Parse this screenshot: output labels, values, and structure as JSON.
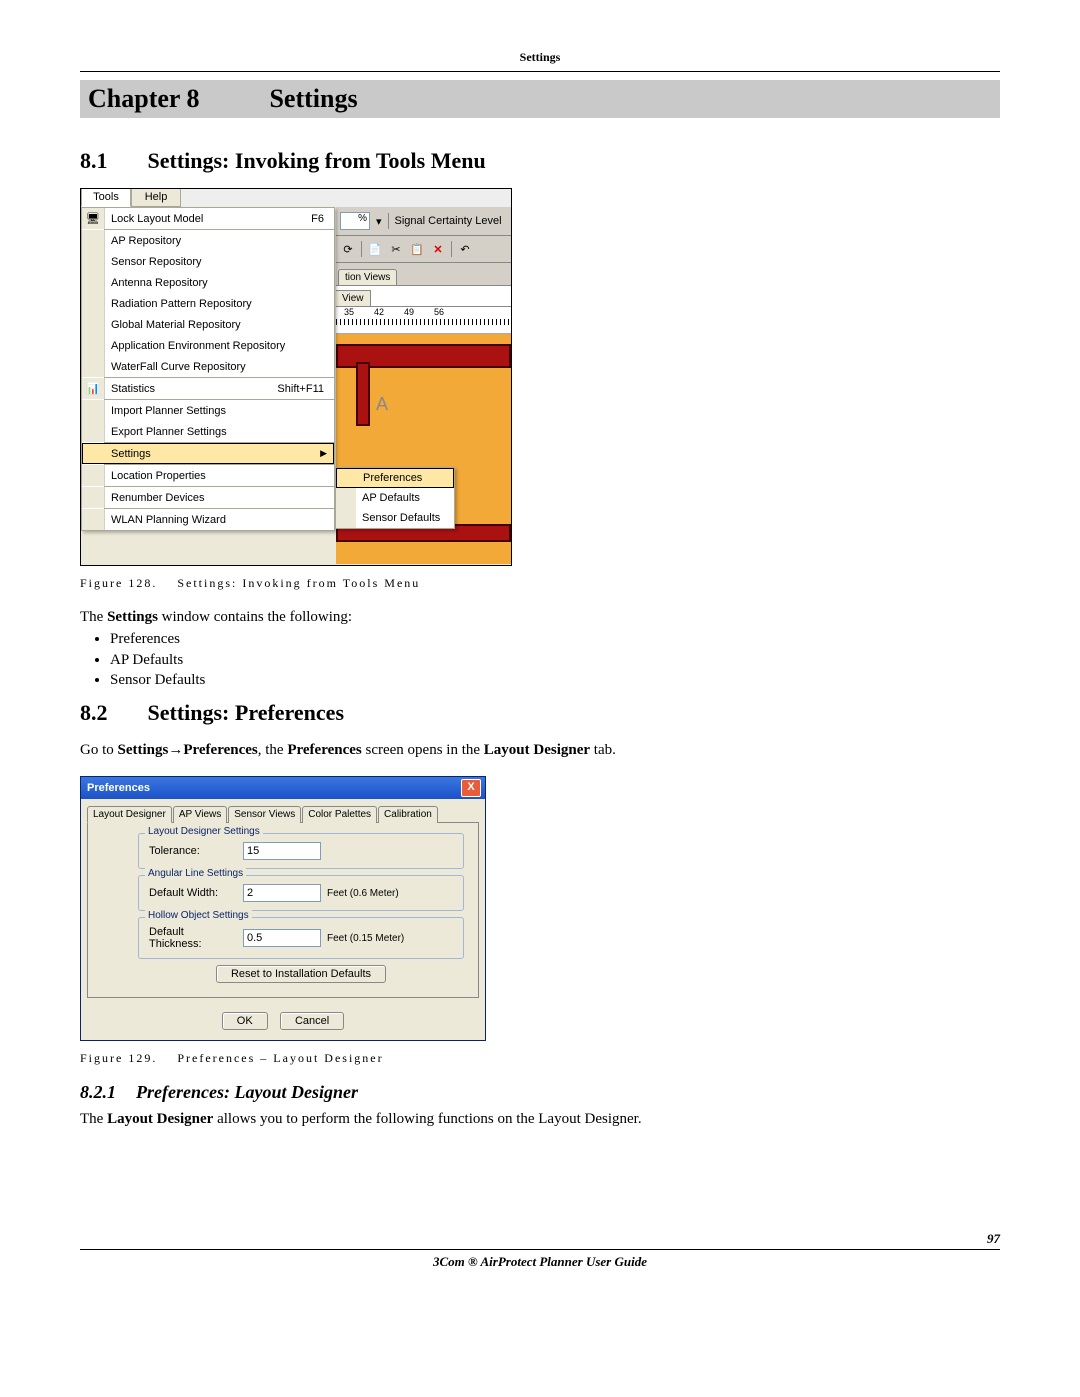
{
  "running_head": "Settings",
  "chapter_label": "Chapter 8",
  "chapter_title": "Settings",
  "sec_81_num": "8.1",
  "sec_81_title": "Settings: Invoking from Tools Menu",
  "sec_82_num": "8.2",
  "sec_82_title": "Settings: Preferences",
  "sec_821_num": "8.2.1",
  "sec_821_title": "Preferences: Layout Designer",
  "fig128": {
    "caption_label": "Figure 128.",
    "caption_text": "Settings: Invoking from Tools Menu",
    "menubar": {
      "tools": "Tools",
      "help": "Help"
    },
    "menu": {
      "lock_model": "Lock Layout Model",
      "lock_model_accel": "F6",
      "ap_repo": "AP Repository",
      "sensor_repo": "Sensor Repository",
      "antenna_repo": "Antenna Repository",
      "rad_repo": "Radiation Pattern Repository",
      "gmat_repo": "Global Material Repository",
      "appenv_repo": "Application Environment Repository",
      "wf_repo": "WaterFall Curve Repository",
      "stats": "Statistics",
      "stats_accel": "Shift+F11",
      "import": "Import Planner Settings",
      "export": "Export Planner Settings",
      "settings": "Settings",
      "loc_props": "Location Properties",
      "renumber": "Renumber Devices",
      "wizard": "WLAN Planning Wizard"
    },
    "submenu": {
      "prefs": "Preferences",
      "apdef": "AP Defaults",
      "sendef": "Sensor Defaults"
    },
    "bg": {
      "pct": "%",
      "sig_cert": "Signal Certainty Level",
      "tion_views": "tion Views",
      "view": "View",
      "r35": "35",
      "r42": "42",
      "r49": "49",
      "r56": "56"
    }
  },
  "para1_prefix": "The ",
  "para1_bold": "Settings",
  "para1_suffix": " window contains the following:",
  "bullet_prefs": "Preferences",
  "bullet_apdef": "AP Defaults",
  "bullet_sendef": "Sensor Defaults",
  "para2_a": "Go to ",
  "para2_b": "Settings",
  "para2_arrow": "→",
  "para2_c": "Preferences",
  "para2_d": ", the ",
  "para2_e": "Preferences",
  "para2_f": " screen opens in the ",
  "para2_g": "Layout Designer",
  "para2_h": " tab.",
  "fig129": {
    "caption_label": "Figure 129.",
    "caption_text": "Preferences – Layout Designer",
    "title": "Preferences",
    "tabs": {
      "layout": "Layout Designer",
      "ap": "AP Views",
      "sensor": "Sensor Views",
      "color": "Color Palettes",
      "calib": "Calibration"
    },
    "g1": {
      "legend": "Layout Designer Settings",
      "tolerance_label": "Tolerance:",
      "tolerance_value": "15"
    },
    "g2": {
      "legend": "Angular Line Settings",
      "width_label": "Default Width:",
      "width_value": "2",
      "width_unit": "Feet (0.6 Meter)"
    },
    "g3": {
      "legend": "Hollow Object Settings",
      "thk_label": "Default Thickness:",
      "thk_value": "0.5",
      "thk_unit": "Feet (0.15 Meter)"
    },
    "reset_btn": "Reset to Installation Defaults",
    "ok_btn": "OK",
    "cancel_btn": "Cancel",
    "close_x": "X"
  },
  "para3_a": "The ",
  "para3_b": "Layout Designer",
  "para3_c": " allows you to perform the following functions on the Layout Designer.",
  "footer_guide": "3Com ® AirProtect Planner User Guide",
  "page_number": "97"
}
